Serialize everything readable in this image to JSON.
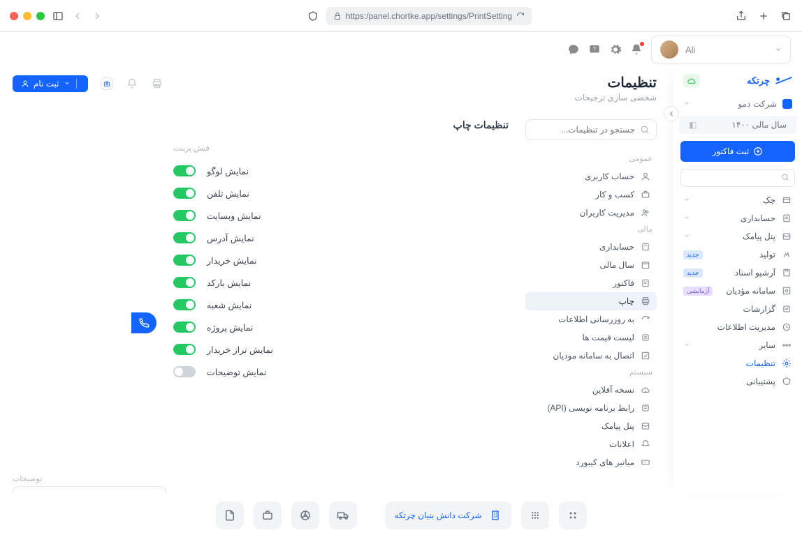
{
  "browser": {
    "url": "https:/panel.chortke.app/settings/PrintSetting"
  },
  "user": {
    "name": "Ali"
  },
  "brand": {
    "name": "چرتکه"
  },
  "company": {
    "name": "شرکت دمو"
  },
  "fiscal_year": {
    "label": "سال مالی ۱۴۰۰"
  },
  "sidebar": {
    "primary_action": "ثبت فاکتور",
    "items": [
      {
        "label": "چک"
      },
      {
        "label": "حسابداری"
      },
      {
        "label": "پنل پیامک"
      },
      {
        "label": "تولید",
        "badge": "جدید",
        "badge_kind": "new"
      },
      {
        "label": "آرشیو اسناد",
        "badge": "جدید",
        "badge_kind": "new"
      },
      {
        "label": "سامانه مؤدیان",
        "badge": "آزمایشی",
        "badge_kind": "exp"
      },
      {
        "label": "گزارشات"
      },
      {
        "label": "مدیریت اطلاعات"
      },
      {
        "label": "سایر"
      },
      {
        "label": "تنظیمات",
        "active": true
      },
      {
        "label": "پشتیبانی"
      }
    ]
  },
  "left_actions": {
    "signup": "ثبت نام"
  },
  "page": {
    "title": "تنظیمات",
    "subtitle": "شخصی سازی ترجیحات"
  },
  "settings_nav": {
    "search_placeholder": "جستجو در تنظیمات...",
    "groups": [
      {
        "label": "عمومی",
        "items": [
          {
            "label": "حساب کاربری"
          },
          {
            "label": "کسب و کار"
          },
          {
            "label": "مدیریت کاربران"
          }
        ]
      },
      {
        "label": "مالی",
        "items": [
          {
            "label": "حسابداری"
          },
          {
            "label": "سال مالی"
          },
          {
            "label": "فاکتور"
          },
          {
            "label": "چاپ",
            "selected": true
          },
          {
            "label": "به روزرسانی اطلاعات"
          },
          {
            "label": "لیست قیمت ها"
          },
          {
            "label": "اتصال به سامانه مودیان"
          }
        ]
      },
      {
        "label": "سیستم",
        "items": [
          {
            "label": "نسخه آفلاین"
          },
          {
            "label": "رابط برنامه نویسی (API)"
          },
          {
            "label": "پنل پیامک"
          },
          {
            "label": "اعلانات"
          },
          {
            "label": "میانبر های کیبورد"
          }
        ]
      }
    ]
  },
  "panel": {
    "title": "تنظیمات چاپ",
    "section_labels": {
      "receipt": "فیش پرینت",
      "description": "توضیحات"
    },
    "toggles": [
      {
        "label": "نمایش لوگو",
        "on": true
      },
      {
        "label": "نمایش تلفن",
        "on": true
      },
      {
        "label": "نمایش وبسایت",
        "on": true
      },
      {
        "label": "نمایش آدرس",
        "on": true
      },
      {
        "label": "نمایش خریدار",
        "on": true
      },
      {
        "label": "نمایش بارکد",
        "on": true
      },
      {
        "label": "نمایش شعبه",
        "on": true
      },
      {
        "label": "نمایش پروژه",
        "on": true
      },
      {
        "label": "نمایش تراز خریدار",
        "on": true
      },
      {
        "label": "نمایش توضیحات",
        "on": false
      }
    ]
  },
  "dock": {
    "company": "شرکت دانش بنیان چرتکه"
  }
}
